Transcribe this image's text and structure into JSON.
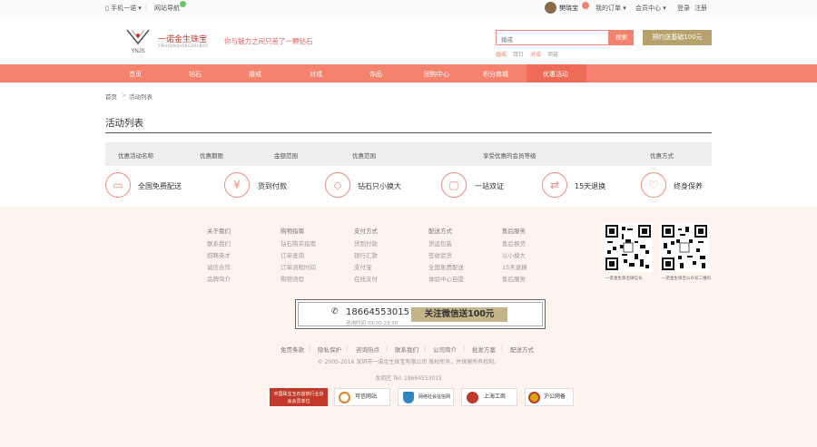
{
  "topbar": {
    "mobile": "手机一诺",
    "stores": "网站导航",
    "username": "樊晓宝",
    "orders": "我的订单",
    "member": "会员中心",
    "login": "登录",
    "register": "注册"
  },
  "header": {
    "brand_cn": "一诺金生珠宝",
    "brand_en": "YINUOJINSHENGZHUBAO",
    "logo_letters": "YNJS",
    "slogan": "你与魅力之间只差了一颗钻石",
    "search_value": "婚戒",
    "search_button": "搜索",
    "promo": "预约送基础100元",
    "hot_links": [
      "婚戒",
      "耳钉",
      "对戒",
      "项链"
    ]
  },
  "nav": [
    "首页",
    "钻石",
    "婚戒",
    "对戒",
    "饰品",
    "团购中心",
    "积分商城",
    "优惠活动"
  ],
  "breadcrumb": {
    "home": "首页",
    "sep": ">",
    "current": "活动列表"
  },
  "page_title": "活动列表",
  "table_headers": [
    "优惠活动名称",
    "优惠期限",
    "金额范围",
    "优惠范围",
    "享受优惠的会员等级",
    "优惠方式"
  ],
  "features": [
    {
      "icon": "gift-box-icon",
      "glyph": "▭",
      "label": "全国免费配送"
    },
    {
      "icon": "yen-icon",
      "glyph": "¥",
      "label": "货到付款"
    },
    {
      "icon": "diamond-icon",
      "glyph": "◇",
      "label": "钻石只小换大"
    },
    {
      "icon": "certificate-icon",
      "glyph": "▢",
      "label": "一站双证"
    },
    {
      "icon": "exchange-icon",
      "glyph": "⇄",
      "label": "15天退换"
    },
    {
      "icon": "shield-icon",
      "glyph": "♡",
      "label": "终身保养"
    }
  ],
  "footer_columns": [
    {
      "title": "关于我们",
      "items": [
        "联系我们",
        "招聘英才",
        "诚信合作",
        "品牌简介"
      ]
    },
    {
      "title": "购物指南",
      "items": [
        "钻石购买指南",
        "订单查询",
        "订单流程时间",
        "购物流程"
      ]
    },
    {
      "title": "支付方式",
      "items": [
        "货到付款",
        "银行汇款",
        "支付宝",
        "在线支付"
      ]
    },
    {
      "title": "配送方式",
      "items": [
        "货运包装",
        "签收验货",
        "全国免费配送",
        "体验中心自提"
      ]
    },
    {
      "title": "售后服务",
      "items": [
        "售后换货",
        "以小换大",
        "15天退换",
        "售后服务"
      ]
    }
  ],
  "qr_labels": [
    "一诺金生珠宝微信号",
    "一诺金生珠宝公众号二维码"
  ],
  "phone": {
    "number": "18664553015",
    "time": "咨询时间 09:00-23:00",
    "wechat": "关注微信送100元"
  },
  "footer_links": [
    "免责条款",
    "隐私保护",
    "咨询热点",
    "联系我们",
    "公司简介",
    "批发方案",
    "配送方式"
  ],
  "copyright": "© 2005-2016 深圳市一诺金生珠宝有限公司 版权所有，并保留所有权利。",
  "address": "龙岗区 Tel: 18664553015",
  "badges": [
    "中国珠宝玉石首饰行业协会会员单位",
    "可信网站",
    "网络社会征信网",
    "上海工商",
    "沪公网备"
  ],
  "colors": {
    "accent": "#f4826e",
    "gold": "#b7a16c",
    "footer_bg": "#fdf4f0"
  }
}
